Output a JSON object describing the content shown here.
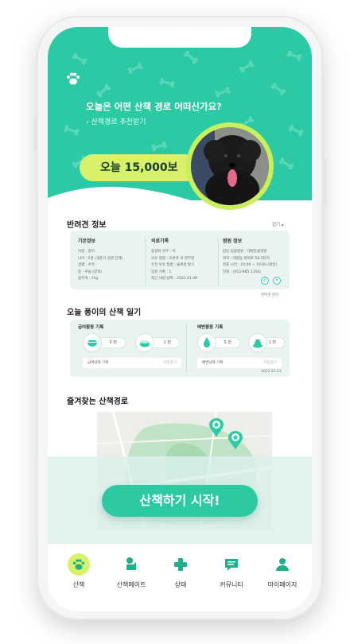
{
  "header": {
    "title": "오늘은 어떤 산책 경로 어떠신가요?",
    "link": "› 산책경로 추천받기",
    "steps": "오늘 15,000보"
  },
  "pet_info": {
    "title": "반려견 정보",
    "toggle": "접기 ▴",
    "columns": [
      {
        "heading": "기본정보",
        "lines": [
          "이름 : 퐁이",
          "나이 : 2살 (개춘기 성견 단계)",
          "성별 : 수컷",
          "종 : 푸들 (갈색)",
          "몸무게 : 7kg"
        ]
      },
      {
        "heading": "의료기록",
        "lines": [
          "중성화 유무 : 아",
          "보유 질병 : 오른쪽 귀 외부병",
          "유전 보유 질병 : 슬개골 탈구",
          "입원 기록 : 1",
          "최근 내원 날짜 : 2022.01.08"
        ]
      },
      {
        "heading": "병원 정보",
        "lines": [
          "담당 동물병원 : 대명동물병원",
          "위치 : 대명동 명덕로 58-2번지",
          "진료 시간 : 10:00 ~ 19:00 (평일)",
          "전화 : (053-985-1356)"
        ]
      }
    ],
    "manage": "반려견 관리"
  },
  "diary": {
    "title": "오늘 퐁이의 산책 일기",
    "feeding": {
      "label": "급여활동 기록",
      "count1": "0 번",
      "count2": "1 번",
      "memo": "급여상태 기록",
      "memo_hint": "자동일기"
    },
    "toilet": {
      "label": "배변활동 기록",
      "count1": "5 번",
      "count2": "1 번",
      "memo": "배변상태 기록",
      "memo_hint": "자동일기"
    },
    "date": "2022.01.13"
  },
  "favorites": {
    "title": "즐겨찾는 산책경로"
  },
  "cta": {
    "label": "산책하기 시작!"
  },
  "tabs": [
    {
      "label": "산책",
      "icon": "paw-icon"
    },
    {
      "label": "산책메이트",
      "icon": "dog-icon"
    },
    {
      "label": "상태",
      "icon": "medical-cross-icon"
    },
    {
      "label": "커뮤니티",
      "icon": "chat-icon"
    },
    {
      "label": "마이페이지",
      "icon": "user-icon"
    }
  ],
  "colors": {
    "accent": "#2cc9a5",
    "lime": "#d8f06a"
  }
}
